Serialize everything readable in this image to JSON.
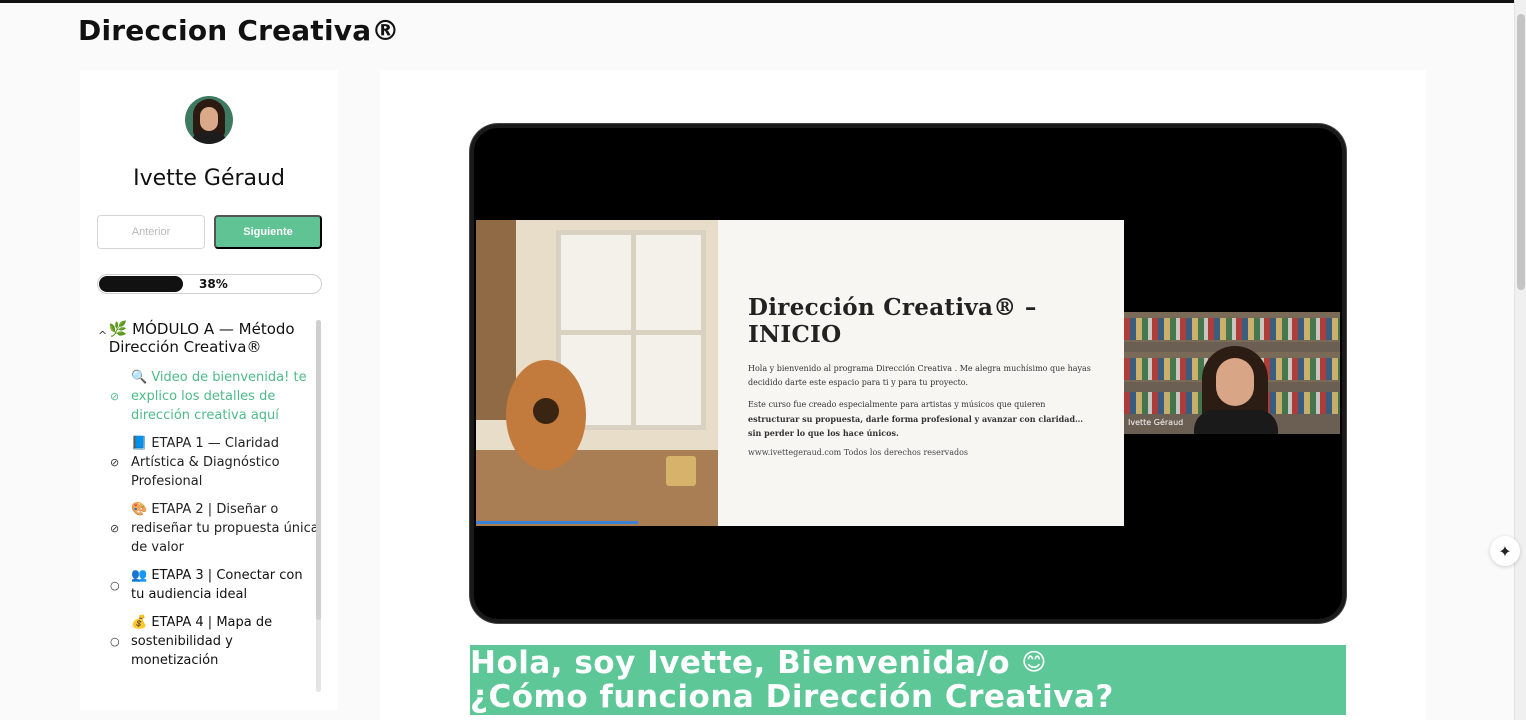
{
  "page": {
    "title": "Direccion Creativa®"
  },
  "sidebar": {
    "author_name": "Ivette Géraud",
    "prev_label": "Anterior",
    "next_label": "Siguiente",
    "progress": {
      "percent": 38,
      "label": "38%"
    },
    "module": {
      "icon": "🌿",
      "title": "MÓDULO A — Método Dirección Creativa®"
    },
    "lessons": [
      {
        "icon": "🔍",
        "title": "Video de bienvenida! te explico los detalles de dirección creativa aquí",
        "status": "current"
      },
      {
        "icon": "📘",
        "title": "ETAPA 1 — Claridad Artística & Diagnóstico Profesional",
        "status": "completed"
      },
      {
        "icon": "🎨",
        "title": "ETAPA 2 | Diseñar o rediseñar tu propuesta única de valor",
        "status": "completed"
      },
      {
        "icon": "👥",
        "title": "ETAPA 3 | Conectar con tu audiencia ideal",
        "status": "incomplete"
      },
      {
        "icon": "💰",
        "title": "ETAPA 4 | Mapa de sostenibilidad y monetización",
        "status": "incomplete"
      }
    ]
  },
  "video": {
    "slide_heading": "Dirección Creativa® – INICIO",
    "slide_p1": "Hola y bienvenido al programa Dirección Creativa . Me alegra muchísimo que hayas decidido darte este espacio para ti y para tu proyecto.",
    "slide_p2": "Este curso fue creado especialmente para artistas y músicos que quieren",
    "slide_p3": "estructurar su propuesta, darle forma profesional y avanzar con claridad… sin perder lo que los hace únicos.",
    "slide_footer": "www.ivettegeraud.com Todos los derechos reservados",
    "cam_label": "Ivette Géraud"
  },
  "banner": {
    "line1": "Hola, soy Ivette, Bienvenida/o",
    "emoji": "😊",
    "line2": "¿Cómo funciona Dirección Creativa?"
  },
  "colors": {
    "accent": "#5ec797",
    "text": "#111111"
  }
}
